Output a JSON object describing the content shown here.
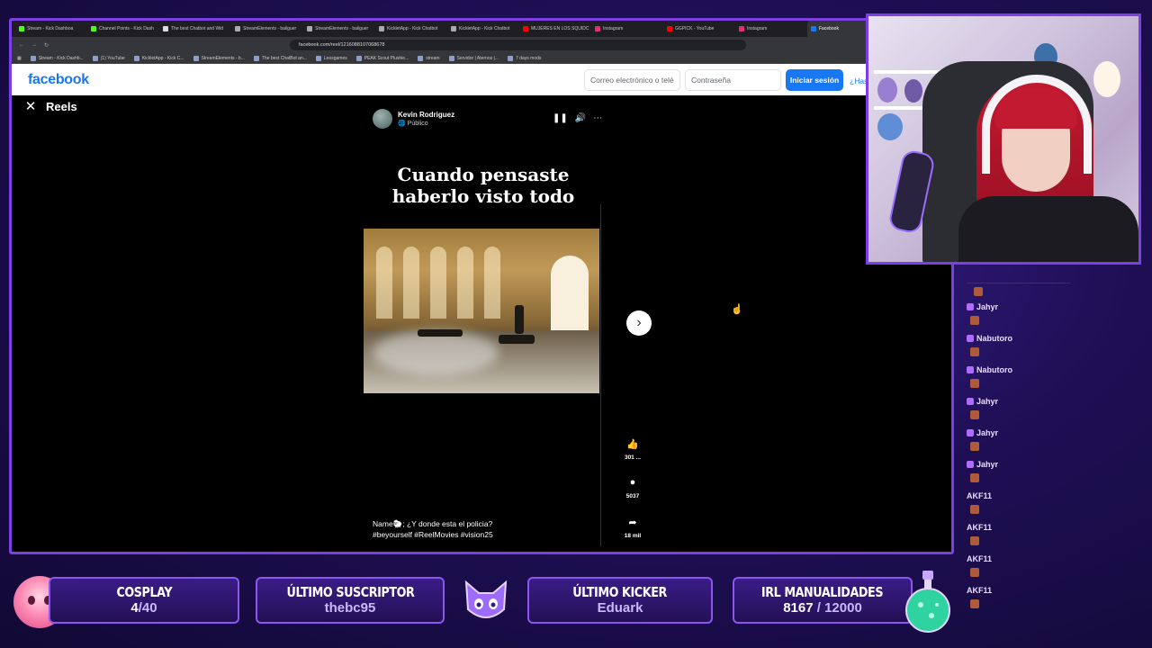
{
  "browser": {
    "tabs": [
      {
        "label": "Stream - Kick Dashboa",
        "color": "#53fc18"
      },
      {
        "label": "Channel Points - Kick Dash",
        "color": "#53fc18"
      },
      {
        "label": "The best Chatbot and Wid",
        "color": "#dddddd"
      },
      {
        "label": "StreamElements - baliguer",
        "color": "#aaaaaa"
      },
      {
        "label": "StreamElements - baliguer",
        "color": "#aaaaaa"
      },
      {
        "label": "KickletApp - Kick Chatbot",
        "color": "#aaaaaa"
      },
      {
        "label": "KickletApp - Kick Chatbot",
        "color": "#aaaaaa"
      },
      {
        "label": "MUJERES EN LOS SQUIDC",
        "color": "#ff0000"
      },
      {
        "label": "Instagram",
        "color": "#e1306c"
      },
      {
        "label": "GGPICK - YouTube",
        "color": "#ff0000"
      },
      {
        "label": "Instagram",
        "color": "#e1306c"
      },
      {
        "label": "Facebook",
        "color": "#1877f2",
        "active": true
      }
    ],
    "url": "facebook.com/reel/1216088107068678",
    "bookmarks": [
      "Stream - Kick Dashb...",
      "(1) YouTube",
      "KickletApp - Kick C...",
      "StreamElements - b...",
      "The best ChatBot an...",
      "Leosgames",
      "PEAK Scout Plushie...",
      "stream",
      "Servidor | Aternos |...",
      "7 days mods"
    ]
  },
  "facebook": {
    "logo": "facebook",
    "email_placeholder": "Correo electrónico o telé",
    "password_placeholder": "Contraseña",
    "login_button": "Iniciar sesión",
    "forgot_link": "¿Has"
  },
  "reels": {
    "title": "Reels",
    "author": "Kevin Rodriguez",
    "privacy": "Público",
    "caption": "Cuando pensaste haberlo visto todo",
    "likes": "301 ...",
    "comments": "5037",
    "shares": "18 mil",
    "description_line1": "Name🐑; ¿Y donde esta el policia?",
    "description_line2": "#beyourself #ReelMovies #vision25"
  },
  "chat": {
    "users": [
      "Jahyr",
      "Nabutoro",
      "Nabutoro",
      "Jahyr",
      "Jahyr",
      "Jahyr",
      "AKF11",
      "AKF11",
      "AKF11",
      "AKF11"
    ]
  },
  "widgets": {
    "cosplay_title": "COSPLAY",
    "cosplay_current": "4",
    "cosplay_goal": "/40",
    "sub_title": "ÚLTIMO SUSCRIPTOR",
    "sub_name": "thebc95",
    "kicker_title": "ÚLTIMO KICKER",
    "kicker_name": "Eduark",
    "irl_title": "IRL MANUALIDADES",
    "irl_current": "8167",
    "irl_goal": " / 12000"
  },
  "colors": {
    "accent": "#7b3fe4",
    "facebook_blue": "#1877f2",
    "background": "#1e0f55"
  }
}
